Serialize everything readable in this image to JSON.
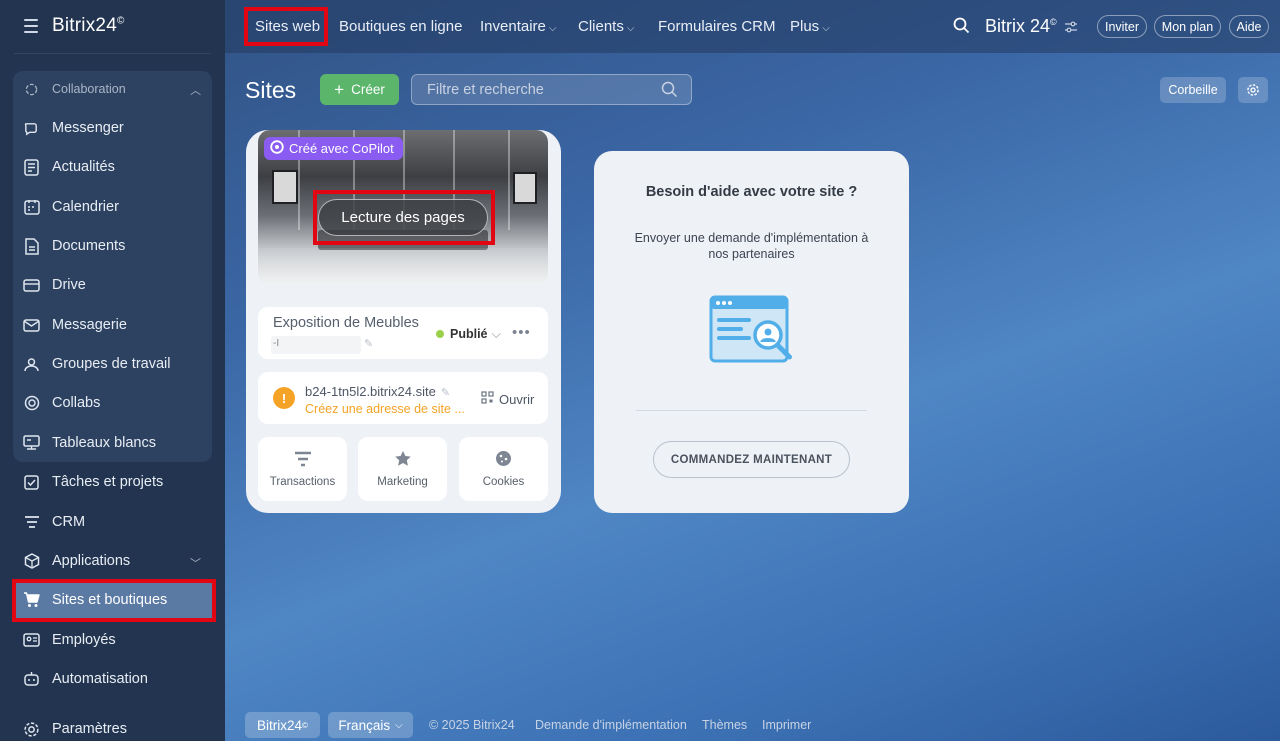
{
  "sidebar": {
    "logo": "Bitrix24",
    "logo_mark": "©",
    "group_label": "Collaboration",
    "items": [
      {
        "label": "Messenger",
        "icon": "messenger-icon"
      },
      {
        "label": "Actualités",
        "icon": "news-icon"
      },
      {
        "label": "Calendrier",
        "icon": "calendar-icon"
      },
      {
        "label": "Documents",
        "icon": "document-icon"
      },
      {
        "label": "Drive",
        "icon": "drive-icon"
      },
      {
        "label": "Messagerie",
        "icon": "mail-icon"
      },
      {
        "label": "Groupes de travail",
        "icon": "groups-icon"
      },
      {
        "label": "Collabs",
        "icon": "collabs-icon"
      },
      {
        "label": "Tableaux blancs",
        "icon": "whiteboard-icon"
      },
      {
        "label": "Tâches et projets",
        "icon": "tasks-icon"
      },
      {
        "label": "CRM",
        "icon": "crm-icon"
      },
      {
        "label": "Applications",
        "icon": "applications-icon"
      },
      {
        "label": "Sites et boutiques",
        "icon": "cart-icon"
      },
      {
        "label": "Employés",
        "icon": "employees-icon"
      },
      {
        "label": "Automatisation",
        "icon": "automation-icon"
      },
      {
        "label": "Paramètres",
        "icon": "settings-icon"
      }
    ]
  },
  "topnav": {
    "items": [
      "Sites web",
      "Boutiques en ligne",
      "Inventaire",
      "Clients",
      "Formulaires CRM",
      "Plus"
    ],
    "brand": "Bitrix 24",
    "brand_mark": "©",
    "invite": "Inviter",
    "plan": "Mon plan",
    "help": "Aide"
  },
  "page": {
    "title": "Sites",
    "create_button": "Créer",
    "search_placeholder": "Filtre et recherche",
    "trash_button": "Corbeille"
  },
  "site_card": {
    "badge": "Créé avec CoPilot",
    "preview_button": "Lecture des pages",
    "name": "Exposition de Meubles",
    "sub_prefix": "-I",
    "status": "Publié",
    "domain": "b24-1tn5l2.bitrix24.site",
    "domain_hint": "Créez une adresse de site ...",
    "open_label": "Ouvrir",
    "tiles": [
      {
        "label": "Transactions",
        "icon": "funnel-icon"
      },
      {
        "label": "Marketing",
        "icon": "star-icon"
      },
      {
        "label": "Cookies",
        "icon": "cookie-icon"
      }
    ]
  },
  "help_card": {
    "title": "Besoin d'aide avec votre site ?",
    "text": "Envoyer une demande d'implémentation à nos partenaires",
    "button": "COMMANDEZ MAINTENANT"
  },
  "footer": {
    "brand": "Bitrix24",
    "brand_mark": "©",
    "language": "Français",
    "copyright": "© 2025 Bitrix24",
    "links": [
      "Demande d'implémentation",
      "Thèmes",
      "Imprimer"
    ]
  },
  "colors": {
    "accent_green": "#5bb66c",
    "copilot_purple": "#8a5cf1",
    "highlight_red": "#e20612",
    "warning_orange": "#f4a326",
    "status_green": "#9ad14a"
  }
}
